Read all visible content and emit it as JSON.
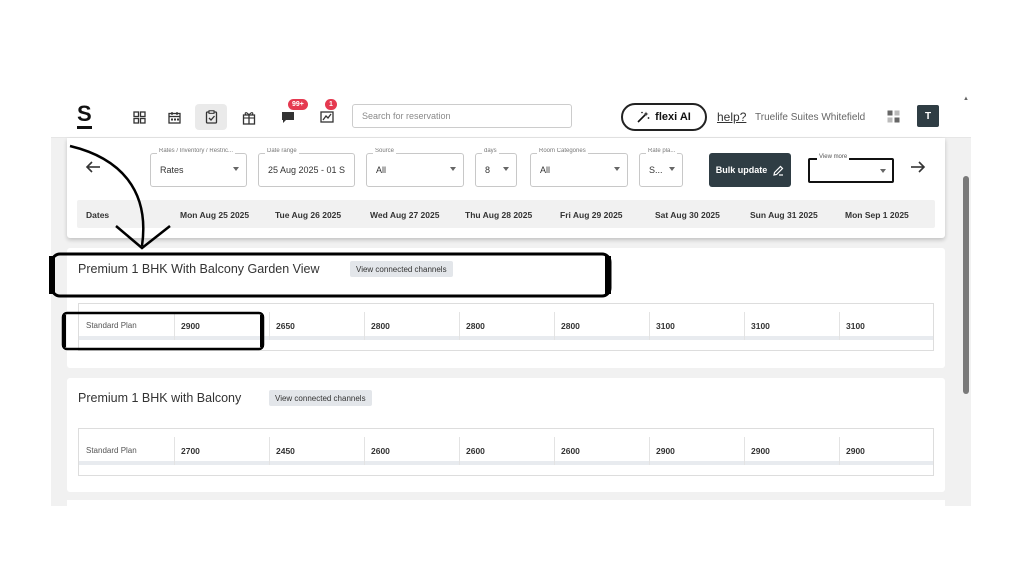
{
  "topbar": {
    "logo": "S",
    "icons": [
      "dashboard-icon",
      "calendar-icon",
      "clipboard-check-icon",
      "gift-icon",
      "chat-icon",
      "chart-icon"
    ],
    "chat_badge": "99+",
    "chart_badge": "1",
    "search_placeholder": "Search for reservation",
    "flexi_label": "flexi AI",
    "help_label": "help?",
    "hotel_name": "Truelife Suites Whitefield",
    "avatar_letter": "T",
    "badge_color": "#e53950",
    "accent_dark": "#2f3d44"
  },
  "filters": {
    "rates": {
      "label": "Rates / Inventory / Restric...",
      "value": "Rates"
    },
    "date_range": {
      "label": "Date range",
      "value": "25 Aug 2025 - 01 S"
    },
    "source": {
      "label": "Source",
      "value": "All"
    },
    "days": {
      "label": "days",
      "value": "8"
    },
    "room_categories": {
      "label": "Room Categories",
      "value": "All"
    },
    "rate_plan": {
      "label": "Rate pla...",
      "value": "S..."
    },
    "bulk_update": "Bulk update",
    "view_more": {
      "label": "View more",
      "value": ""
    }
  },
  "dates": {
    "header": "Dates",
    "columns": [
      "Mon Aug 25 2025",
      "Tue Aug 26 2025",
      "Wed Aug 27 2025",
      "Thu Aug 28 2025",
      "Fri Aug 29 2025",
      "Sat Aug 30 2025",
      "Sun Aug 31 2025",
      "Mon Sep 1 2025"
    ]
  },
  "rooms": [
    {
      "title": "Premium 1 BHK With Balcony Garden View",
      "channels_label": "View connected channels",
      "plan": "Standard Plan",
      "rates": [
        "2900",
        "2650",
        "2800",
        "2800",
        "2800",
        "3100",
        "3100",
        "3100"
      ]
    },
    {
      "title": "Premium 1 BHK with Balcony",
      "channels_label": "View connected channels",
      "plan": "Standard Plan",
      "rates": [
        "2700",
        "2450",
        "2600",
        "2600",
        "2600",
        "2900",
        "2900",
        "2900"
      ]
    }
  ]
}
